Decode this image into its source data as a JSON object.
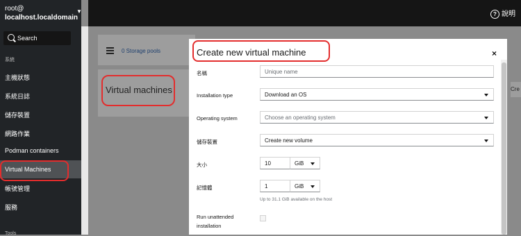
{
  "sidebar": {
    "host_user": "root@",
    "host_name": "localhost.localdomain",
    "search_label": "Search",
    "section_system": "系統",
    "items": [
      {
        "label": "主機狀態"
      },
      {
        "label": "系統日誌"
      },
      {
        "label": "儲存裝置"
      },
      {
        "label": "網路作業"
      },
      {
        "label": "Podman containers"
      },
      {
        "label": "Virtual Machines",
        "active": true
      },
      {
        "label": "帳號管理"
      },
      {
        "label": "服務"
      }
    ],
    "section_tools": "Tools"
  },
  "topbar": {
    "help_label": "說明"
  },
  "background": {
    "storage_pools": "0 Storage pools",
    "vm_title": "Virtual machines",
    "right_stub": "Cre"
  },
  "modal": {
    "title": "Create new virtual machine",
    "close": "×",
    "fields": {
      "name_label": "名稱",
      "name_placeholder": "Unique name",
      "install_type_label": "Installation type",
      "install_type_value": "Download an OS",
      "os_label": "Operating system",
      "os_placeholder": "Choose an operating system",
      "storage_label": "儲存裝置",
      "storage_value": "Create new volume",
      "size_label": "大小",
      "size_value": "10",
      "size_unit": "GiB",
      "memory_label": "記憶體",
      "memory_value": "1",
      "memory_unit": "GiB",
      "memory_helper": "Up to 31.1 GiB available on the host",
      "unattended_label_1": "Run unattended",
      "unattended_label_2": "installation"
    }
  },
  "colors": {
    "annotation": "#e32d2d",
    "sidebar_bg": "#212427",
    "topbar_bg": "#151515"
  }
}
